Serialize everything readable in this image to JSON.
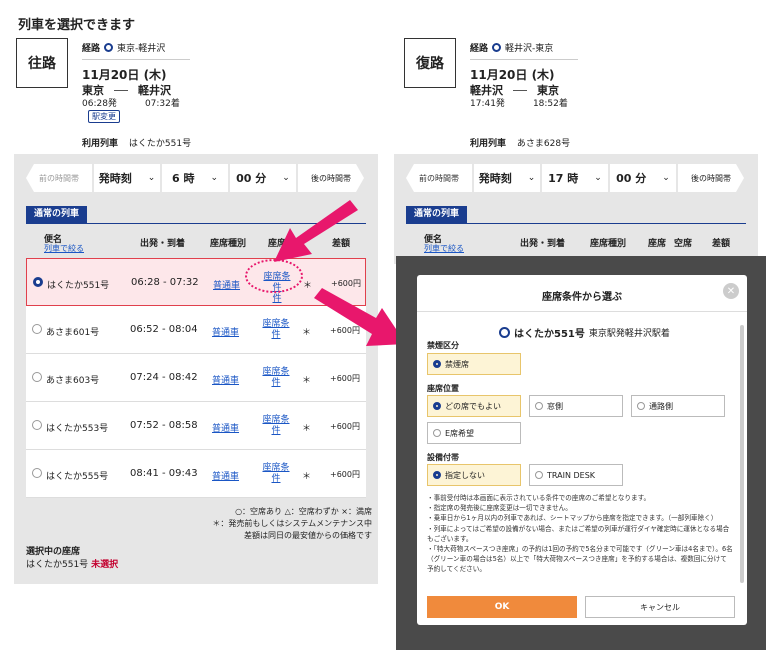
{
  "page_title": "列車を選択できます",
  "outbound": {
    "label": "往路",
    "route_label": "経路",
    "route": "東京-軽井沢",
    "date": "11月20日 (木)",
    "from": "東京",
    "to": "軽井沢",
    "dep": "06:28発",
    "arr": "07:32着",
    "change": "駅変更",
    "use_label": "利用列車",
    "use_train": "はくたか551号"
  },
  "return": {
    "label": "復路",
    "route_label": "経路",
    "route": "軽井沢-東京",
    "date": "11月20日 (木)",
    "from": "軽井沢",
    "to": "東京",
    "dep": "17:41発",
    "arr": "18:52着",
    "use_label": "利用列車",
    "use_train": "あさま628号"
  },
  "timebar1": {
    "prev": "前の時間帯",
    "mode": "発時刻",
    "hour": "6 時",
    "min": "00 分",
    "next": "後の時間帯"
  },
  "timebar2": {
    "prev": "前の時間帯",
    "mode": "発時刻",
    "hour": "17 時",
    "min": "00 分",
    "next": "後の時間帯"
  },
  "list_tab": "通常の列車",
  "columns": {
    "name": "便名",
    "name_sub": "列車で絞る",
    "time": "出発・到着",
    "seat_type": "座席種別",
    "seat": "座席",
    "vacancy": "空席",
    "price": "差額"
  },
  "trains": [
    {
      "name": "はくたか551号",
      "time": "06:28 - 07:32",
      "seat_type": "普通車",
      "seat": "座席条件",
      "seat2": "件",
      "vac": "＊",
      "price": "+600円"
    },
    {
      "name": "あさま601号",
      "time": "06:52 - 08:04",
      "seat_type": "普通車",
      "seat": "座席条",
      "seat2": "件",
      "vac": "＊",
      "price": "+600円"
    },
    {
      "name": "あさま603号",
      "time": "07:24 - 08:42",
      "seat_type": "普通車",
      "seat": "座席条",
      "seat2": "件",
      "vac": "＊",
      "price": "+600円"
    },
    {
      "name": "はくたか553号",
      "time": "07:52 - 08:58",
      "seat_type": "普通車",
      "seat": "座席条",
      "seat2": "件",
      "vac": "＊",
      "price": "+600円"
    },
    {
      "name": "はくたか555号",
      "time": "08:41 - 09:43",
      "seat_type": "普通車",
      "seat": "座席条",
      "seat2": "件",
      "vac": "＊",
      "price": "+600円"
    }
  ],
  "legend": [
    "○：空席あり △：空席わずか ×：満席",
    "＊：発売前もしくはシステムメンテナンス中",
    "差額は同日の最安値からの価格です"
  ],
  "selected_seat": {
    "label": "選択中の座席",
    "train": "はくたか551号",
    "status": "未選択"
  },
  "modal": {
    "title": "座席条件から選ぶ",
    "train": "はくたか551号",
    "route": "東京駅発軽井沢駅着",
    "smoking_label": "禁煙区分",
    "smoking": [
      "禁煙席"
    ],
    "position_label": "座席位置",
    "positions": [
      "どの席でもよい",
      "窓側",
      "通路側",
      "E席希望"
    ],
    "facility_label": "設備付帯",
    "facilities": [
      "指定しない",
      "TRAIN DESK"
    ],
    "notes": [
      "・事前受付時は本画面に表示されている条件での座席のご希望となります。",
      "・指定席の発売後に座席変更は一切できません。",
      "・乗車日から1ヶ月以内の列車であれば、シートマップから座席を指定できます。（一部列車除く）",
      "・列車によってはご希望の設備がない場合、またはご希望の列車が運行ダイヤ確定時に運休となる場合もございます。",
      "・「特大荷物スペースつき座席」の予約は1回の予約で5名分まで可能です（グリーン車は4名まで）。6名（グリーン車の場合は5名）以上で「特大荷物スペースつき座席」を予約する場合は、複数回に分けて予約してください。"
    ],
    "ok": "OK",
    "cancel": "キャンセル"
  },
  "colors": {
    "navy": "#1a3d8f",
    "pink": "#e8176c",
    "orange": "#f08a3c",
    "red": "#c3002f"
  }
}
